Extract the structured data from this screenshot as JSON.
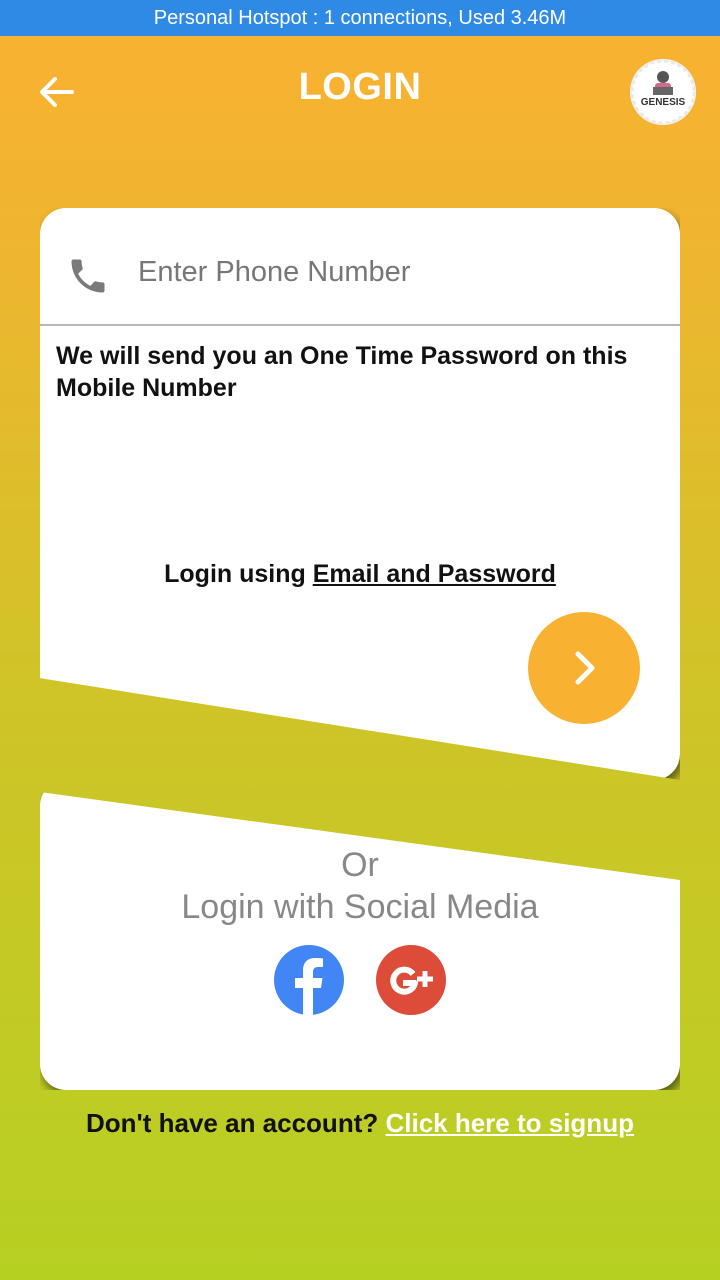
{
  "status_bar": {
    "text": "Personal Hotspot : 1 connections, Used 3.46M"
  },
  "header": {
    "title": "LOGIN",
    "logo_text": "GENESIS"
  },
  "phone": {
    "placeholder": "Enter Phone Number",
    "value": ""
  },
  "otp_message": "We will send you an One Time Password on this Mobile Number",
  "email_login": {
    "prefix": "Login using ",
    "link": "Email and Password"
  },
  "social": {
    "or": "Or",
    "label": "Login with Social Media"
  },
  "signup": {
    "prefix": "Don't have an account? ",
    "link": "Click here to signup"
  },
  "icons": {
    "back": "arrow-back-icon",
    "phone": "phone-icon",
    "next": "chevron-right-icon",
    "facebook": "facebook-icon",
    "google_plus": "google-plus-icon"
  },
  "colors": {
    "status_bar": "#2F8AE6",
    "accent": "#F9B131",
    "facebook": "#4285F4",
    "google_plus": "#DD4B39"
  }
}
